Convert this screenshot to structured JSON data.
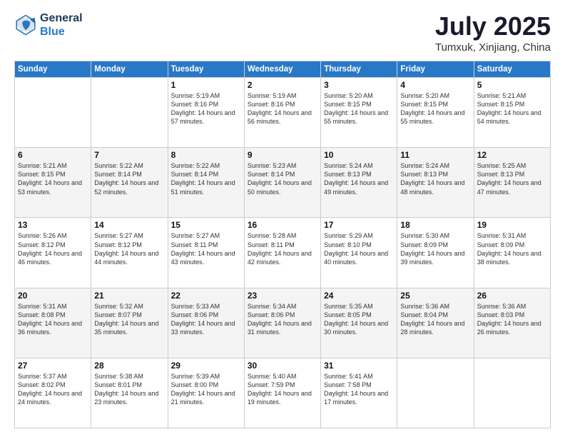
{
  "header": {
    "logo_line1": "General",
    "logo_line2": "Blue",
    "month": "July 2025",
    "location": "Tumxuk, Xinjiang, China"
  },
  "weekdays": [
    "Sunday",
    "Monday",
    "Tuesday",
    "Wednesday",
    "Thursday",
    "Friday",
    "Saturday"
  ],
  "weeks": [
    [
      {
        "day": "",
        "sunrise": "",
        "sunset": "",
        "daylight": ""
      },
      {
        "day": "",
        "sunrise": "",
        "sunset": "",
        "daylight": ""
      },
      {
        "day": "1",
        "sunrise": "Sunrise: 5:19 AM",
        "sunset": "Sunset: 8:16 PM",
        "daylight": "Daylight: 14 hours and 57 minutes."
      },
      {
        "day": "2",
        "sunrise": "Sunrise: 5:19 AM",
        "sunset": "Sunset: 8:16 PM",
        "daylight": "Daylight: 14 hours and 56 minutes."
      },
      {
        "day": "3",
        "sunrise": "Sunrise: 5:20 AM",
        "sunset": "Sunset: 8:15 PM",
        "daylight": "Daylight: 14 hours and 55 minutes."
      },
      {
        "day": "4",
        "sunrise": "Sunrise: 5:20 AM",
        "sunset": "Sunset: 8:15 PM",
        "daylight": "Daylight: 14 hours and 55 minutes."
      },
      {
        "day": "5",
        "sunrise": "Sunrise: 5:21 AM",
        "sunset": "Sunset: 8:15 PM",
        "daylight": "Daylight: 14 hours and 54 minutes."
      }
    ],
    [
      {
        "day": "6",
        "sunrise": "Sunrise: 5:21 AM",
        "sunset": "Sunset: 8:15 PM",
        "daylight": "Daylight: 14 hours and 53 minutes."
      },
      {
        "day": "7",
        "sunrise": "Sunrise: 5:22 AM",
        "sunset": "Sunset: 8:14 PM",
        "daylight": "Daylight: 14 hours and 52 minutes."
      },
      {
        "day": "8",
        "sunrise": "Sunrise: 5:22 AM",
        "sunset": "Sunset: 8:14 PM",
        "daylight": "Daylight: 14 hours and 51 minutes."
      },
      {
        "day": "9",
        "sunrise": "Sunrise: 5:23 AM",
        "sunset": "Sunset: 8:14 PM",
        "daylight": "Daylight: 14 hours and 50 minutes."
      },
      {
        "day": "10",
        "sunrise": "Sunrise: 5:24 AM",
        "sunset": "Sunset: 8:13 PM",
        "daylight": "Daylight: 14 hours and 49 minutes."
      },
      {
        "day": "11",
        "sunrise": "Sunrise: 5:24 AM",
        "sunset": "Sunset: 8:13 PM",
        "daylight": "Daylight: 14 hours and 48 minutes."
      },
      {
        "day": "12",
        "sunrise": "Sunrise: 5:25 AM",
        "sunset": "Sunset: 8:13 PM",
        "daylight": "Daylight: 14 hours and 47 minutes."
      }
    ],
    [
      {
        "day": "13",
        "sunrise": "Sunrise: 5:26 AM",
        "sunset": "Sunset: 8:12 PM",
        "daylight": "Daylight: 14 hours and 46 minutes."
      },
      {
        "day": "14",
        "sunrise": "Sunrise: 5:27 AM",
        "sunset": "Sunset: 8:12 PM",
        "daylight": "Daylight: 14 hours and 44 minutes."
      },
      {
        "day": "15",
        "sunrise": "Sunrise: 5:27 AM",
        "sunset": "Sunset: 8:11 PM",
        "daylight": "Daylight: 14 hours and 43 minutes."
      },
      {
        "day": "16",
        "sunrise": "Sunrise: 5:28 AM",
        "sunset": "Sunset: 8:11 PM",
        "daylight": "Daylight: 14 hours and 42 minutes."
      },
      {
        "day": "17",
        "sunrise": "Sunrise: 5:29 AM",
        "sunset": "Sunset: 8:10 PM",
        "daylight": "Daylight: 14 hours and 40 minutes."
      },
      {
        "day": "18",
        "sunrise": "Sunrise: 5:30 AM",
        "sunset": "Sunset: 8:09 PM",
        "daylight": "Daylight: 14 hours and 39 minutes."
      },
      {
        "day": "19",
        "sunrise": "Sunrise: 5:31 AM",
        "sunset": "Sunset: 8:09 PM",
        "daylight": "Daylight: 14 hours and 38 minutes."
      }
    ],
    [
      {
        "day": "20",
        "sunrise": "Sunrise: 5:31 AM",
        "sunset": "Sunset: 8:08 PM",
        "daylight": "Daylight: 14 hours and 36 minutes."
      },
      {
        "day": "21",
        "sunrise": "Sunrise: 5:32 AM",
        "sunset": "Sunset: 8:07 PM",
        "daylight": "Daylight: 14 hours and 35 minutes."
      },
      {
        "day": "22",
        "sunrise": "Sunrise: 5:33 AM",
        "sunset": "Sunset: 8:06 PM",
        "daylight": "Daylight: 14 hours and 33 minutes."
      },
      {
        "day": "23",
        "sunrise": "Sunrise: 5:34 AM",
        "sunset": "Sunset: 8:06 PM",
        "daylight": "Daylight: 14 hours and 31 minutes."
      },
      {
        "day": "24",
        "sunrise": "Sunrise: 5:35 AM",
        "sunset": "Sunset: 8:05 PM",
        "daylight": "Daylight: 14 hours and 30 minutes."
      },
      {
        "day": "25",
        "sunrise": "Sunrise: 5:36 AM",
        "sunset": "Sunset: 8:04 PM",
        "daylight": "Daylight: 14 hours and 28 minutes."
      },
      {
        "day": "26",
        "sunrise": "Sunrise: 5:36 AM",
        "sunset": "Sunset: 8:03 PM",
        "daylight": "Daylight: 14 hours and 26 minutes."
      }
    ],
    [
      {
        "day": "27",
        "sunrise": "Sunrise: 5:37 AM",
        "sunset": "Sunset: 8:02 PM",
        "daylight": "Daylight: 14 hours and 24 minutes."
      },
      {
        "day": "28",
        "sunrise": "Sunrise: 5:38 AM",
        "sunset": "Sunset: 8:01 PM",
        "daylight": "Daylight: 14 hours and 23 minutes."
      },
      {
        "day": "29",
        "sunrise": "Sunrise: 5:39 AM",
        "sunset": "Sunset: 8:00 PM",
        "daylight": "Daylight: 14 hours and 21 minutes."
      },
      {
        "day": "30",
        "sunrise": "Sunrise: 5:40 AM",
        "sunset": "Sunset: 7:59 PM",
        "daylight": "Daylight: 14 hours and 19 minutes."
      },
      {
        "day": "31",
        "sunrise": "Sunrise: 5:41 AM",
        "sunset": "Sunset: 7:58 PM",
        "daylight": "Daylight: 14 hours and 17 minutes."
      },
      {
        "day": "",
        "sunrise": "",
        "sunset": "",
        "daylight": ""
      },
      {
        "day": "",
        "sunrise": "",
        "sunset": "",
        "daylight": ""
      }
    ]
  ]
}
